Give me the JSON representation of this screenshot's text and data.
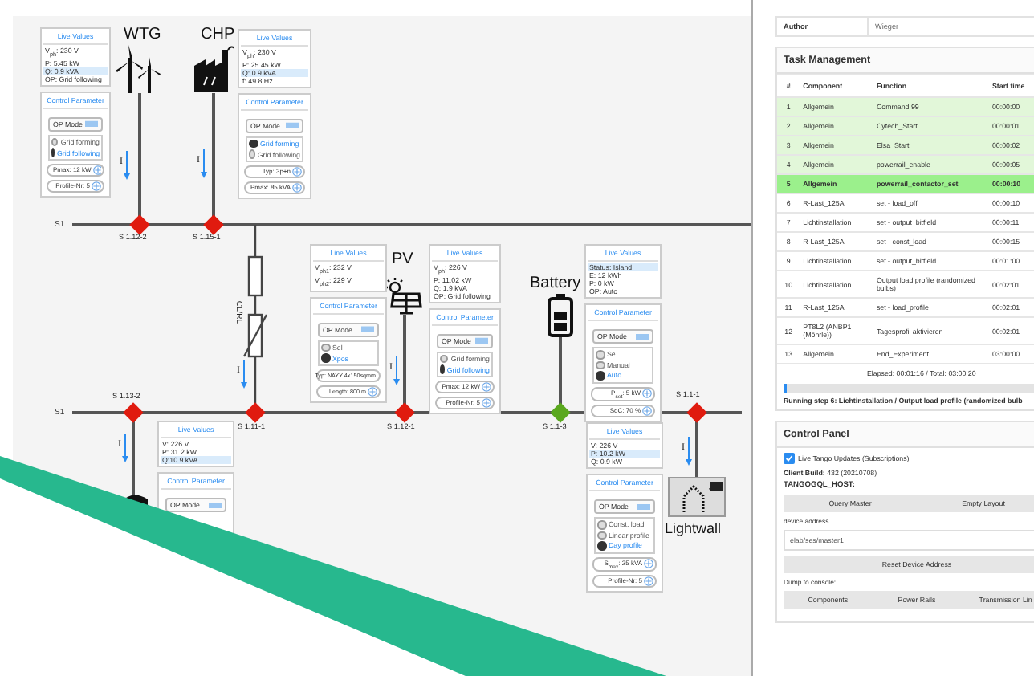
{
  "diagram": {
    "buses": [
      {
        "label": "S1"
      },
      {
        "label": "S1"
      }
    ],
    "switches": [
      {
        "label": "S 1.12-2",
        "color": "#e01b0f"
      },
      {
        "label": "S 1.15-1",
        "color": "#e01b0f"
      },
      {
        "label": "S 1.13-2",
        "color": "#e01b0f"
      },
      {
        "label": "S 1.11-1",
        "color": "#e01b0f"
      },
      {
        "label": "S 1.12-1",
        "color": "#e01b0f"
      },
      {
        "label": "S 1.1-3",
        "color": "#5aa81e"
      },
      {
        "label": "S 1.1-1",
        "color": "#e01b0f"
      }
    ],
    "units": [
      {
        "kind": "wtg",
        "label": "WTG"
      },
      {
        "kind": "chp",
        "label": "CHP"
      },
      {
        "kind": "pv",
        "label": "PV"
      },
      {
        "kind": "battery",
        "label": "Battery"
      },
      {
        "kind": "lightwall",
        "label": "Lightwall"
      }
    ],
    "cable_label": "CL/RL",
    "currents": [
      {
        "label": "I"
      },
      {
        "label": "I"
      },
      {
        "label": "I"
      },
      {
        "label": "I"
      },
      {
        "label": "I"
      },
      {
        "label": "I"
      }
    ],
    "panels": [
      {
        "live": {
          "title": "Live Values",
          "rows": [
            {
              "text": "V$_{ph}$:  230 V",
              "highlighted": false
            },
            {
              "text": "P:  5.45 kW",
              "highlighted": false
            },
            {
              "text": "Q:  0.9 kVA",
              "highlighted": true
            },
            {
              "text": "OP: Grid following",
              "highlighted": false
            }
          ]
        },
        "control": {
          "title": "Control Parameter",
          "mode": "OP Mode",
          "options": [
            {
              "label": "Grid forming",
              "selected": false
            },
            {
              "label": "Grid following",
              "selected": true
            }
          ],
          "fields": [
            "Pmax: 12 kW",
            "Profile-Nr: 5"
          ]
        }
      },
      {
        "live": {
          "title": "Live Values",
          "rows": [
            {
              "text": "V$_{ph}$:  230 V",
              "highlighted": false
            },
            {
              "text": "P:  25.45 kW",
              "highlighted": false
            },
            {
              "text": "Q:  0.9 kVA",
              "highlighted": true
            },
            {
              "text": "f:  49.8 Hz",
              "highlighted": false
            }
          ]
        },
        "control": {
          "title": "Control Parameter",
          "mode": "OP Mode",
          "options": [
            {
              "label": "Grid forming",
              "selected": true
            },
            {
              "label": "Grid following",
              "selected": false
            }
          ],
          "fields": [
            "Typ: 3p+n",
            "Pmax: 85 kVA"
          ]
        }
      },
      {
        "live": {
          "title": "Line Values",
          "rows": [
            {
              "text": "V$_{ph1}$: 232 V",
              "highlighted": false
            },
            {
              "text": "V$_{ph2}$: 229 V",
              "highlighted": false
            }
          ]
        },
        "control": {
          "title": "Control Parameter",
          "mode": "OP Mode",
          "options": [
            {
              "label": "Sel",
              "selected": false
            },
            {
              "label": "Xpos",
              "selected": true
            }
          ],
          "fields": [
            "Typ: NAYY 4x150sqmm",
            "Length: 800 m"
          ]
        }
      },
      {
        "live": {
          "title": "Live Values",
          "rows": [
            {
              "text": "V$_{ph}$:  226 V",
              "highlighted": false
            },
            {
              "text": "P:  11.02 kW",
              "highlighted": false
            },
            {
              "text": "Q:  1.9 kVA",
              "highlighted": false
            },
            {
              "text": "OP: Grid following",
              "highlighted": false
            }
          ]
        },
        "control": {
          "title": "Control Parameter",
          "mode": "OP Mode",
          "options": [
            {
              "label": "Grid forming",
              "selected": false
            },
            {
              "label": "Grid following",
              "selected": true
            }
          ],
          "fields": [
            "Pmax: 12 kW",
            "Profile-Nr: 5"
          ]
        }
      },
      {
        "live": {
          "title": "Live Values",
          "rows": [
            {
              "text": "Status: Island",
              "highlighted": true
            },
            {
              "text": "E: 12 kWh",
              "highlighted": false
            },
            {
              "text": "P: 0 kW",
              "highlighted": false
            },
            {
              "text": "OP: Auto",
              "highlighted": false
            }
          ]
        },
        "control": {
          "title": "Control Parameter",
          "mode": "OP Mode",
          "options": [
            {
              "label": "Se...",
              "selected": false
            },
            {
              "label": "Manual",
              "selected": false
            },
            {
              "label": "Auto",
              "selected": true
            }
          ],
          "fields": [
            "P$_{set}$: 5 kW",
            "SoC: 70 %"
          ]
        }
      },
      {
        "live": {
          "title": "Live Values",
          "rows": [
            {
              "text": "V: 226 V",
              "highlighted": false
            },
            {
              "text": "P: 31.2 kW",
              "highlighted": false
            },
            {
              "text": "Q:10.9 kVA",
              "highlighted": true
            }
          ]
        },
        "control": {
          "title": "Control Parameter",
          "mode": "OP Mode"
        }
      },
      {
        "live": {
          "title": "Live Values",
          "rows": [
            {
              "text": "V: 226 V",
              "highlighted": false
            },
            {
              "text": "P: 10.2 kW",
              "highlighted": true
            },
            {
              "text": "Q: 0.9 kW",
              "highlighted": false
            }
          ]
        },
        "control": {
          "title": "Control Parameter",
          "mode": "OP Mode",
          "options": [
            {
              "label": "Const. load",
              "selected": false
            },
            {
              "label": "Linear profile",
              "selected": false
            },
            {
              "label": "Day profile",
              "selected": true
            }
          ],
          "fields": [
            "S$_{max}$: 25 kVA",
            "Profile-Nr: 5"
          ]
        }
      }
    ]
  },
  "info": {
    "label": "Author",
    "value": "Wieger"
  },
  "task_management": {
    "title": "Task Management",
    "columns": [
      "#",
      "Component",
      "Function",
      "Start time"
    ],
    "rows": [
      {
        "number": "1",
        "component": "Allgemein",
        "function": "Command 99",
        "start": "00:00:00",
        "done": true,
        "selected": false
      },
      {
        "number": "2",
        "component": "Allgemein",
        "function": "Cytech_Start",
        "start": "00:00:01",
        "done": true,
        "selected": false
      },
      {
        "number": "3",
        "component": "Allgemein",
        "function": "Elsa_Start",
        "start": "00:00:02",
        "done": true,
        "selected": false
      },
      {
        "number": "4",
        "component": "Allgemein",
        "function": "powerrail_enable",
        "start": "00:00:05",
        "done": true,
        "selected": false
      },
      {
        "number": "5",
        "component": "Allgemein",
        "function": "powerrail_contactor_set",
        "start": "00:00:10",
        "done": false,
        "selected": true
      },
      {
        "number": "6",
        "component": "R-Last_125A",
        "function": "set - load_off",
        "start": "00:00:10",
        "done": false,
        "selected": false
      },
      {
        "number": "7",
        "component": "Lichtinstallation",
        "function": "set - output_bitfield",
        "start": "00:00:11",
        "done": false,
        "selected": false
      },
      {
        "number": "8",
        "component": "R-Last_125A",
        "function": "set - const_load",
        "start": "00:00:15",
        "done": false,
        "selected": false
      },
      {
        "number": "9",
        "component": "Lichtinstallation",
        "function": "set - output_bitfield",
        "start": "00:01:00",
        "done": false,
        "selected": false
      },
      {
        "number": "10",
        "component": "Lichtinstallation",
        "function": "Output load profile (randomized bulbs)",
        "start": "00:02:01",
        "done": false,
        "selected": false
      },
      {
        "number": "11",
        "component": "R-Last_125A",
        "function": "set - load_profile",
        "start": "00:02:01",
        "done": false,
        "selected": false
      },
      {
        "number": "12",
        "component": "PT8L2 (ANBP1 (Möhrle))",
        "function": "Tagesprofil aktivieren",
        "start": "00:02:01",
        "done": false,
        "selected": false
      },
      {
        "number": "13",
        "component": "Allgemein",
        "function": "End_Experiment",
        "start": "03:00:00",
        "done": false,
        "selected": false
      }
    ],
    "elapsed": "Elapsed: 00:01:16 / Total: 03:00:20",
    "progress": {
      "level": 0.01
    },
    "status": "Running step 6: Lichtinstallation / Output load profile (randomized bulb"
  },
  "control_panel": {
    "title": "Control Panel",
    "live_updates": {
      "label": "Live Tango Updates (Subscriptions)",
      "checked": true
    },
    "client_build": "**Client Build:** 432 (20210708)",
    "host_label": "TANGOGQL_HOST:",
    "buttons": [
      "Query Master",
      "Empty Layout"
    ],
    "address": {
      "label": "device address",
      "value": "elab/ses/master1"
    },
    "reset_button": "Reset Device Address",
    "dump_label": "Dump to console:",
    "dump_buttons": [
      "Components",
      "Power Rails",
      "Transmission Lin"
    ]
  }
}
